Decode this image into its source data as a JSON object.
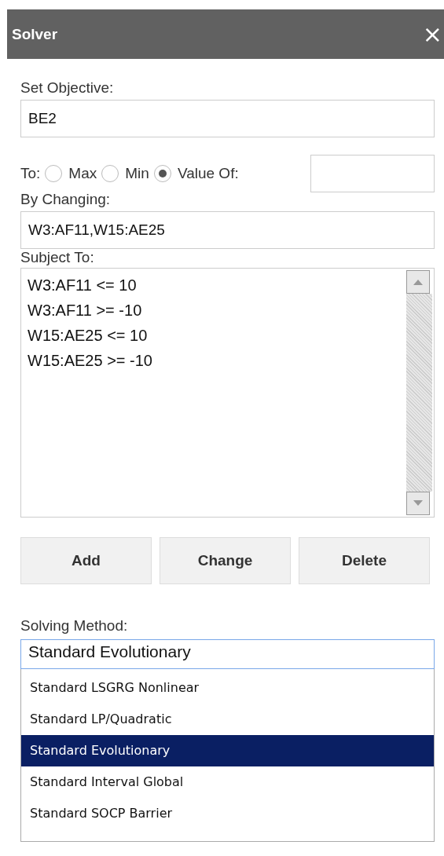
{
  "window": {
    "title": "Solver",
    "close": "×"
  },
  "objective": {
    "label": "Set Objective:",
    "value": "BE2"
  },
  "to": {
    "label": "To:",
    "options": [
      {
        "label": "Max",
        "selected": false
      },
      {
        "label": "Min",
        "selected": false
      },
      {
        "label": "Value Of:",
        "selected": true
      }
    ]
  },
  "by_changing": {
    "label": "By Changing:",
    "value": "W3:AF11,W15:AE25"
  },
  "subject_to": {
    "label": "Subject To:",
    "constraints": [
      "W3:AF11 <= 10",
      "W3:AF11 >= -10",
      "W15:AE25 <= 10",
      "W15:AE25 >= -10"
    ]
  },
  "buttons": [
    "Add",
    "Change",
    "Delete"
  ],
  "solving_method": {
    "label": "Solving Method:",
    "value": "Standard Evolutionary",
    "options": [
      {
        "label": "Standard LSGRG Nonlinear",
        "selected": false
      },
      {
        "label": "Standard LP/Quadratic",
        "selected": false
      },
      {
        "label": "Standard Evolutionary",
        "selected": true
      },
      {
        "label": "Standard Interval Global",
        "selected": false
      },
      {
        "label": "Standard SOCP Barrier",
        "selected": false
      }
    ]
  }
}
